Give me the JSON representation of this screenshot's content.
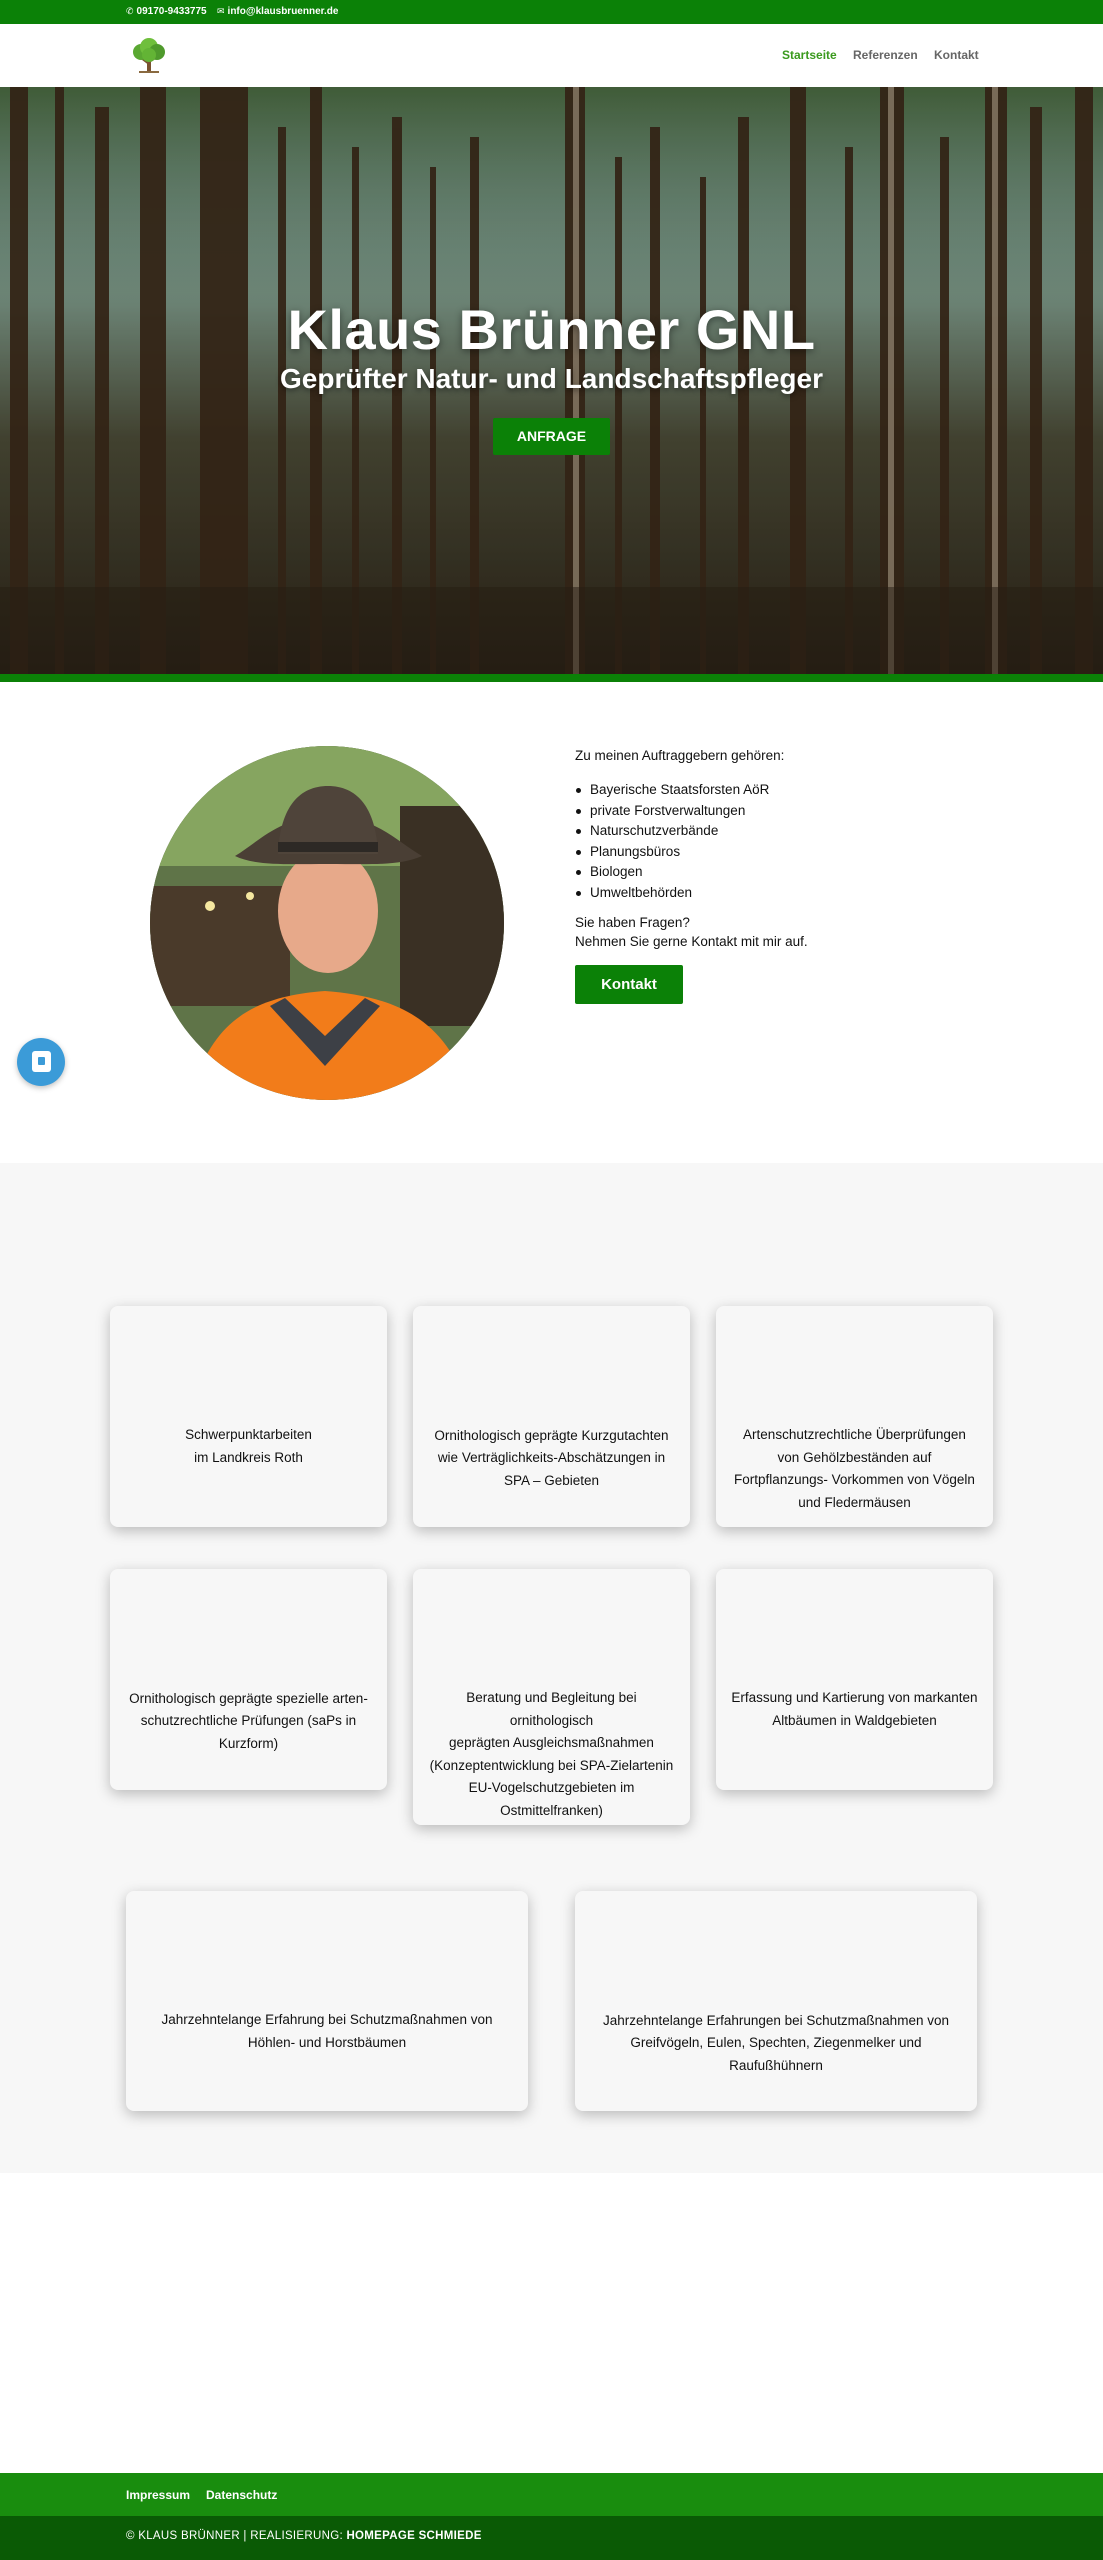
{
  "topbar": {
    "phone": "09170-9433775",
    "email": "info@klausbruenner.de",
    "phone_icon": "phone-icon",
    "email_icon": "envelope-icon"
  },
  "nav": {
    "items": [
      {
        "label": "Startseite",
        "active": true
      },
      {
        "label": "Referenzen",
        "active": false
      },
      {
        "label": "Kontakt",
        "active": false
      }
    ]
  },
  "hero": {
    "title": "Klaus Brünner GNL",
    "subtitle": "Geprüfter Natur- und Landschaftspfleger",
    "button": "ANFRAGE"
  },
  "about": {
    "intro": "Zu meinen Auftraggebern gehören:",
    "clients": [
      "Bayerische Staatsforsten AöR",
      "private Forstverwaltungen",
      "Naturschutzverbände",
      "Planungsbüros",
      "Biologen",
      "Umweltbehörden"
    ],
    "question": "Sie haben Fragen?",
    "invite": "Nehmen Sie gerne Kontakt mit mir auf.",
    "button": "Kontakt"
  },
  "services": [
    {
      "lines": [
        "Schwerpunktarbeiten",
        "im Landkreis Roth"
      ]
    },
    {
      "lines": [
        "Ornithologisch geprägte Kurzgutachten",
        "wie Verträglichkeits-Abschätzungen in",
        "SPA – Gebieten"
      ]
    },
    {
      "lines": [
        "Artenschutzrechtliche Überprüfungen",
        "von Gehölzbeständen auf",
        "Fortpflanzungs- Vorkommen von Vögeln",
        "und Fledermäusen"
      ]
    },
    {
      "lines": [
        "Ornithologisch geprägte spezielle arten-",
        "schutzrechtliche Prüfungen (saPs in",
        "Kurzform)"
      ]
    },
    {
      "lines": [
        "Beratung und Begleitung bei",
        "ornithologisch",
        "geprägten Ausgleichsmaßnahmen",
        "(Konzeptentwicklung bei SPA-Zielartenin",
        "EU-Vogelschutzgebieten im",
        "Ostmittelfranken)"
      ]
    },
    {
      "lines": [
        "Erfassung und Kartierung von markanten",
        "Altbäumen in Waldgebieten"
      ]
    },
    {
      "lines": [
        "Jahrzehntelange Erfahrung bei Schutzmaßnahmen von",
        "Höhlen- und Horstbäumen"
      ]
    },
    {
      "lines": [
        "Jahrzehntelange Erfahrungen bei Schutzmaßnahmen von",
        "Greifvögeln, Eulen, Spechten, Ziegenmelker und",
        "Raufußhühnern"
      ]
    }
  ],
  "footer": {
    "links": [
      "Impressum",
      "Datenschutz"
    ],
    "copyright": "© KLAUS BRÜNNER | REALISIERUNG:",
    "credit": "HOMEPAGE SCHMIEDE"
  },
  "colors": {
    "brand_green": "#0b8107",
    "nav_active": "#3a9a1d",
    "footer_top": "#198d0e",
    "footer_bottom": "#0a5a05",
    "chat_blue": "#3b9bd8"
  }
}
